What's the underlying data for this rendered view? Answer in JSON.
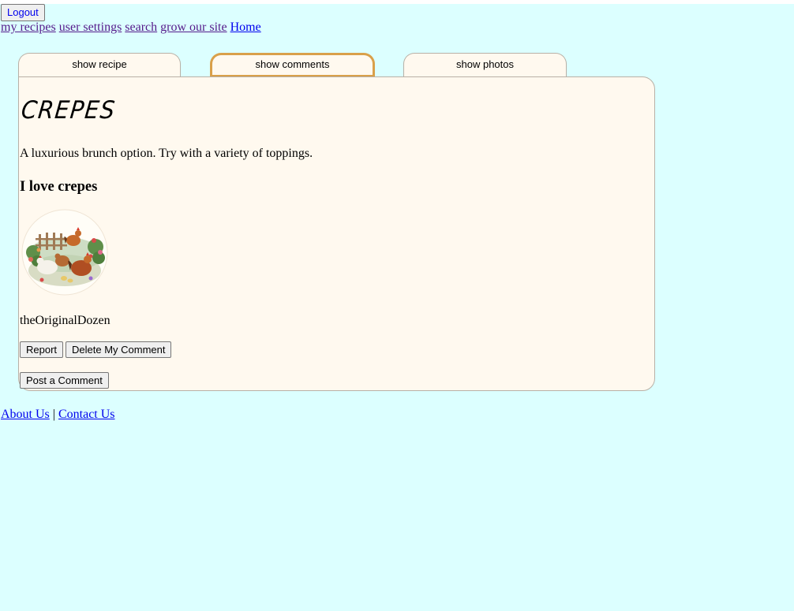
{
  "header": {
    "logout_label": "Logout"
  },
  "nav": {
    "my_recipes": "my recipes",
    "user_settings": "user settings",
    "search": "search",
    "grow_our_site": "grow our site",
    "home": "Home"
  },
  "tabs": [
    {
      "label": "show recipe",
      "active": false
    },
    {
      "label": "show comments",
      "active": true
    },
    {
      "label": "show photos",
      "active": false
    }
  ],
  "recipe": {
    "title": "CREPES",
    "description": "A luxurious brunch option. Try with a variety of toppings."
  },
  "comment": {
    "text": "I love crepes",
    "username": "theOriginalDozen",
    "report_label": "Report",
    "delete_label": "Delete My Comment"
  },
  "post_comment_label": "Post a Comment",
  "footer": {
    "about": "About Us",
    "separator": "|",
    "contact": "Contact Us"
  },
  "colors": {
    "page_bg": "#dcffff",
    "panel_bg": "#fff9ef",
    "active_tab_border": "#d9a04a"
  }
}
